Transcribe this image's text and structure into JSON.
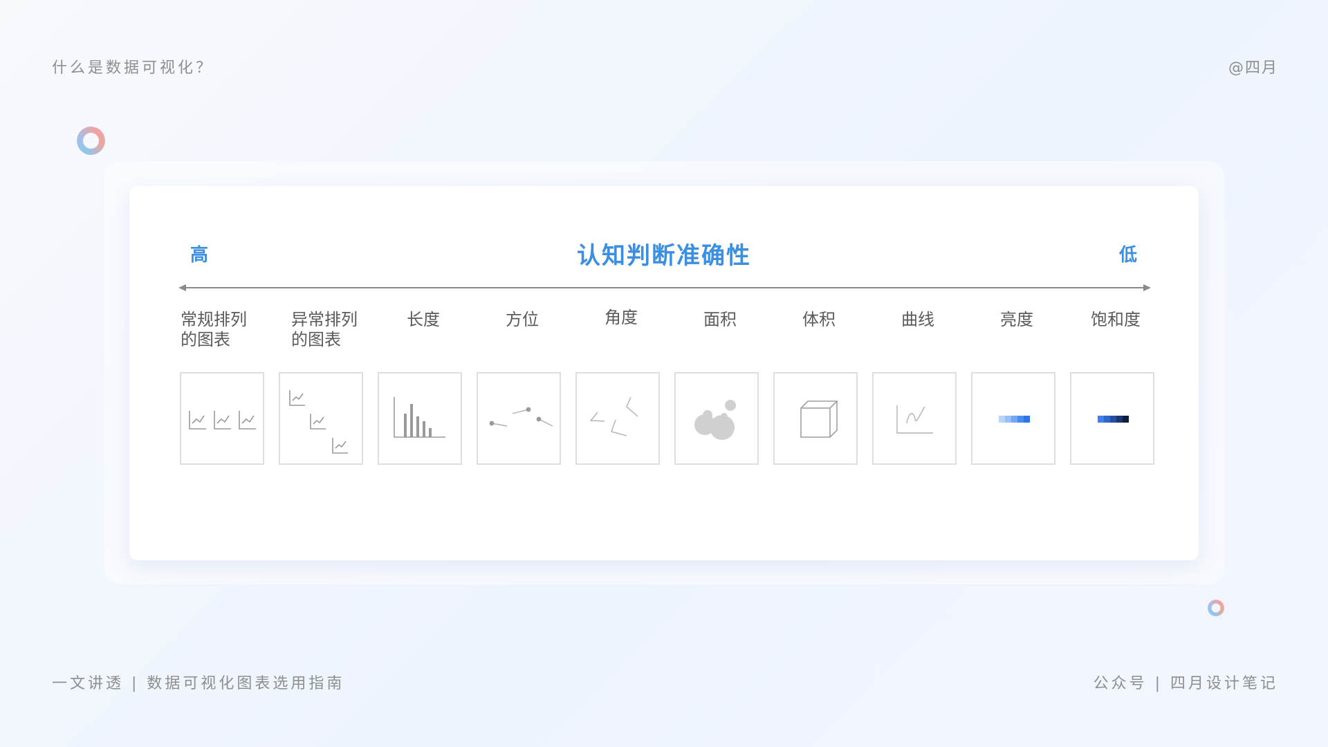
{
  "page": {
    "top_left": "什么是数据可视化？",
    "top_right": "@四月",
    "bottom_left": "一文讲透 | 数据可视化图表选用指南",
    "bottom_right": "公众号 | 四月设计笔记"
  },
  "diagram": {
    "title": "认知判断准确性",
    "high_label": "高",
    "low_label": "低",
    "items": [
      {
        "label_line1": "常规排列",
        "label_line2": "的图表",
        "icon": "regular-small-multiples-icon"
      },
      {
        "label_line1": "异常排列",
        "label_line2": "的图表",
        "icon": "irregular-small-multiples-icon"
      },
      {
        "label_line1": "长度",
        "icon": "length-bars-icon"
      },
      {
        "label_line1": "方位",
        "icon": "position-dots-icon"
      },
      {
        "label_line1": "角度",
        "icon": "angle-lines-icon"
      },
      {
        "label_line1": "面积",
        "icon": "area-circles-icon"
      },
      {
        "label_line1": "体积",
        "icon": "volume-cube-icon"
      },
      {
        "label_line1": "曲线",
        "icon": "curve-line-icon"
      },
      {
        "label_line1": "亮度",
        "icon": "luminance-gradient-icon"
      },
      {
        "label_line1": "饱和度",
        "icon": "saturation-gradient-icon"
      }
    ],
    "colors": {
      "accent": "#3a8fe0",
      "icon_gray": "#9a9a9a",
      "box_border": "#dedede",
      "luminance": [
        "#b8d4fb",
        "#98c0fa",
        "#72a7f6",
        "#4a8bf0",
        "#2f74e6"
      ],
      "saturation": [
        "#3f7fe6",
        "#2f66c9",
        "#254f9e",
        "#1b3770",
        "#0f1e3e"
      ]
    }
  }
}
